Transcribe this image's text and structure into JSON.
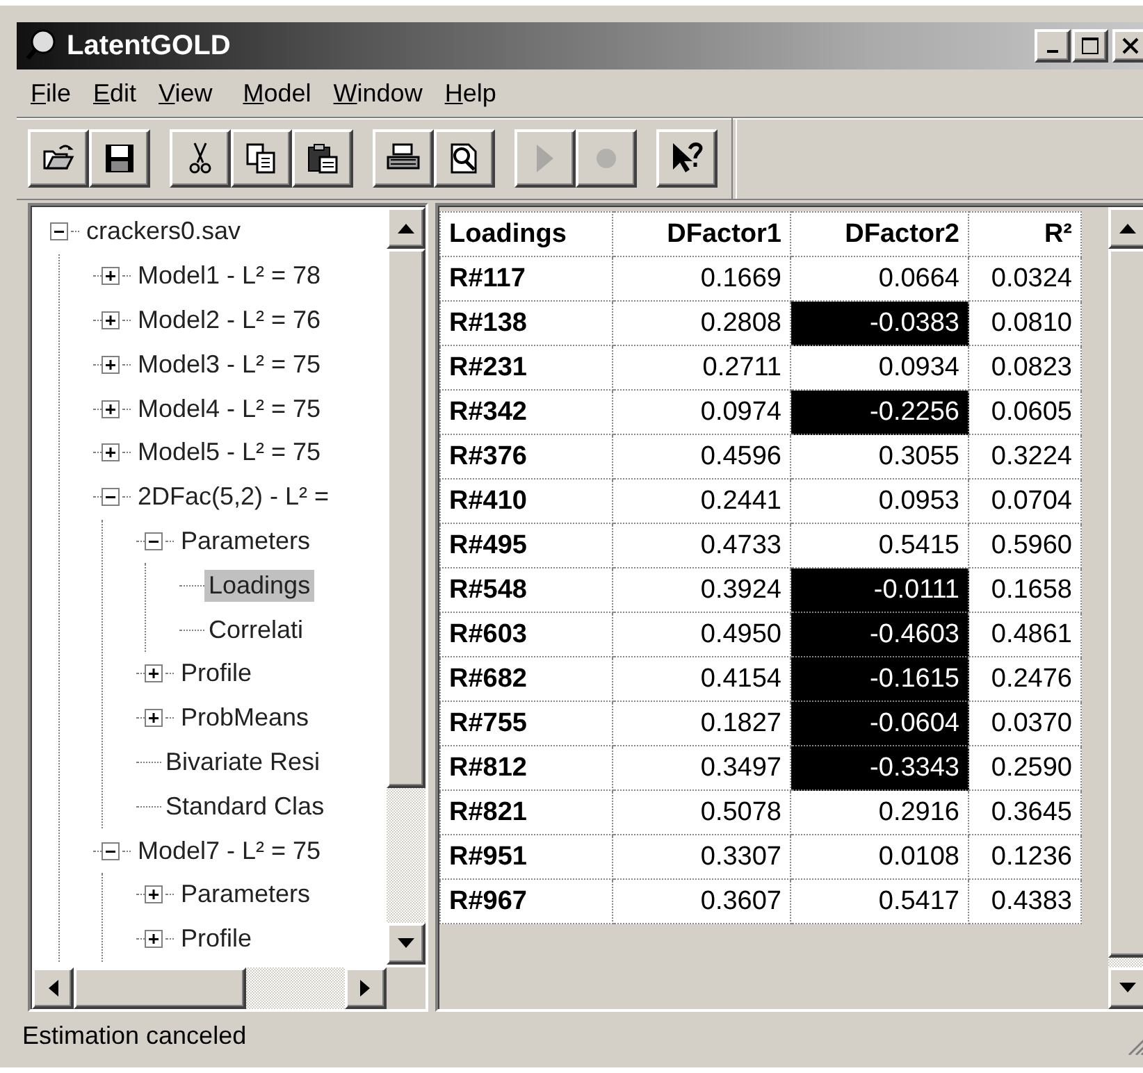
{
  "window": {
    "title": "LatentGOLD"
  },
  "menu": [
    "File",
    "Edit",
    "View",
    "Model",
    "Window",
    "Help"
  ],
  "toolbar": [
    [
      {
        "kind": "open",
        "disabled": false
      },
      {
        "kind": "save",
        "disabled": false
      }
    ],
    [
      {
        "kind": "cut",
        "disabled": false
      },
      {
        "kind": "copy",
        "disabled": false
      },
      {
        "kind": "paste",
        "disabled": false
      }
    ],
    [
      {
        "kind": "print",
        "disabled": false
      },
      {
        "kind": "preview",
        "disabled": false
      }
    ],
    [
      {
        "kind": "run",
        "disabled": true
      },
      {
        "kind": "stop",
        "disabled": true
      }
    ],
    [
      {
        "kind": "help",
        "disabled": false
      }
    ]
  ],
  "tree": [
    {
      "label": "crackers0.sav",
      "expanded": true,
      "selected": false,
      "children": [
        {
          "label": "Model1 - L² = 78",
          "expanded": false,
          "selected": false
        },
        {
          "label": "Model2 - L² = 76",
          "expanded": false,
          "selected": false
        },
        {
          "label": "Model3 - L² = 75",
          "expanded": false,
          "selected": false
        },
        {
          "label": "Model4 - L² = 75",
          "expanded": false,
          "selected": false
        },
        {
          "label": "Model5 - L² = 75",
          "expanded": false,
          "selected": false
        },
        {
          "label": "2DFac(5,2) - L² =",
          "expanded": true,
          "selected": false,
          "children": [
            {
              "label": "Parameters",
              "expanded": true,
              "selected": false,
              "children": [
                {
                  "label": "Loadings",
                  "selected": true
                },
                {
                  "label": "Correlati",
                  "selected": false
                }
              ]
            },
            {
              "label": "Profile",
              "expanded": false,
              "selected": false
            },
            {
              "label": "ProbMeans",
              "expanded": false,
              "selected": false
            },
            {
              "label": "Bivariate Resi",
              "selected": false
            },
            {
              "label": "Standard Clas",
              "selected": false
            }
          ]
        },
        {
          "label": "Model7 - L² = 75",
          "expanded": true,
          "selected": false,
          "children": [
            {
              "label": "Parameters",
              "expanded": false,
              "selected": false
            },
            {
              "label": "Profile",
              "expanded": false,
              "selected": false
            }
          ]
        }
      ]
    }
  ],
  "table": {
    "columns": [
      "Loadings",
      "DFactor1",
      "DFactor2",
      "R²"
    ],
    "rows": [
      {
        "label": "R#117",
        "dfactor1": "0.1669",
        "dfactor2": "0.0664",
        "dfactor2_highlighted": false,
        "r2": "0.0324"
      },
      {
        "label": "R#138",
        "dfactor1": "0.2808",
        "dfactor2": "-0.0383",
        "dfactor2_highlighted": true,
        "r2": "0.0810"
      },
      {
        "label": "R#231",
        "dfactor1": "0.2711",
        "dfactor2": "0.0934",
        "dfactor2_highlighted": false,
        "r2": "0.0823"
      },
      {
        "label": "R#342",
        "dfactor1": "0.0974",
        "dfactor2": "-0.2256",
        "dfactor2_highlighted": true,
        "r2": "0.0605"
      },
      {
        "label": "R#376",
        "dfactor1": "0.4596",
        "dfactor2": "0.3055",
        "dfactor2_highlighted": false,
        "r2": "0.3224"
      },
      {
        "label": "R#410",
        "dfactor1": "0.2441",
        "dfactor2": "0.0953",
        "dfactor2_highlighted": false,
        "r2": "0.0704"
      },
      {
        "label": "R#495",
        "dfactor1": "0.4733",
        "dfactor2": "0.5415",
        "dfactor2_highlighted": false,
        "r2": "0.5960"
      },
      {
        "label": "R#548",
        "dfactor1": "0.3924",
        "dfactor2": "-0.0111",
        "dfactor2_highlighted": true,
        "r2": "0.1658"
      },
      {
        "label": "R#603",
        "dfactor1": "0.4950",
        "dfactor2": "-0.4603",
        "dfactor2_highlighted": true,
        "r2": "0.4861"
      },
      {
        "label": "R#682",
        "dfactor1": "0.4154",
        "dfactor2": "-0.1615",
        "dfactor2_highlighted": true,
        "r2": "0.2476"
      },
      {
        "label": "R#755",
        "dfactor1": "0.1827",
        "dfactor2": "-0.0604",
        "dfactor2_highlighted": true,
        "r2": "0.0370"
      },
      {
        "label": "R#812",
        "dfactor1": "0.3497",
        "dfactor2": "-0.3343",
        "dfactor2_highlighted": true,
        "r2": "0.2590"
      },
      {
        "label": "R#821",
        "dfactor1": "0.5078",
        "dfactor2": "0.2916",
        "dfactor2_highlighted": false,
        "r2": "0.3645"
      },
      {
        "label": "R#951",
        "dfactor1": "0.3307",
        "dfactor2": "0.0108",
        "dfactor2_highlighted": false,
        "r2": "0.1236"
      },
      {
        "label": "R#967",
        "dfactor1": "0.3607",
        "dfactor2": "0.5417",
        "dfactor2_highlighted": false,
        "r2": "0.4383"
      }
    ]
  },
  "status_bar": "Estimation canceled"
}
